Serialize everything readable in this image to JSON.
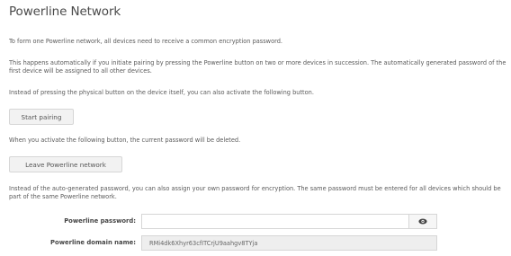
{
  "page": {
    "title": "Powerline Network"
  },
  "paragraphs": {
    "intro": "To form one Powerline network, all devices need to receive a common encryption password.",
    "automatic": "This happens automatically if you initiate pairing by pressing the Powerline button on two or more devices in succession. The automatically generated password of the first device will be assigned to all other devices.",
    "instead_button": "Instead of pressing the physical button on the device itself, you can also activate the following button.",
    "leave_warning": "When you activate the following button, the current password will be deleted.",
    "own_password": "Instead of the auto-generated password, you can also assign your own password for encryption. The same password must be entered for all devices which should be part of the same Powerline network."
  },
  "buttons": {
    "start_pairing": "Start pairing",
    "leave_network": "Leave Powerline network"
  },
  "form": {
    "password_label": "Powerline password:",
    "password_value": "",
    "password_placeholder": "",
    "show_password_icon": "eye-icon",
    "domain_label": "Powerline domain name:",
    "domain_value": "RMi4dk6Xhyr63cfITCrjU9aahgv8TYja"
  },
  "colors": {
    "text": "#555555",
    "button_bg": "#f2f2f2",
    "border": "#d6d6d6",
    "readonly_bg": "#eeeeee"
  }
}
